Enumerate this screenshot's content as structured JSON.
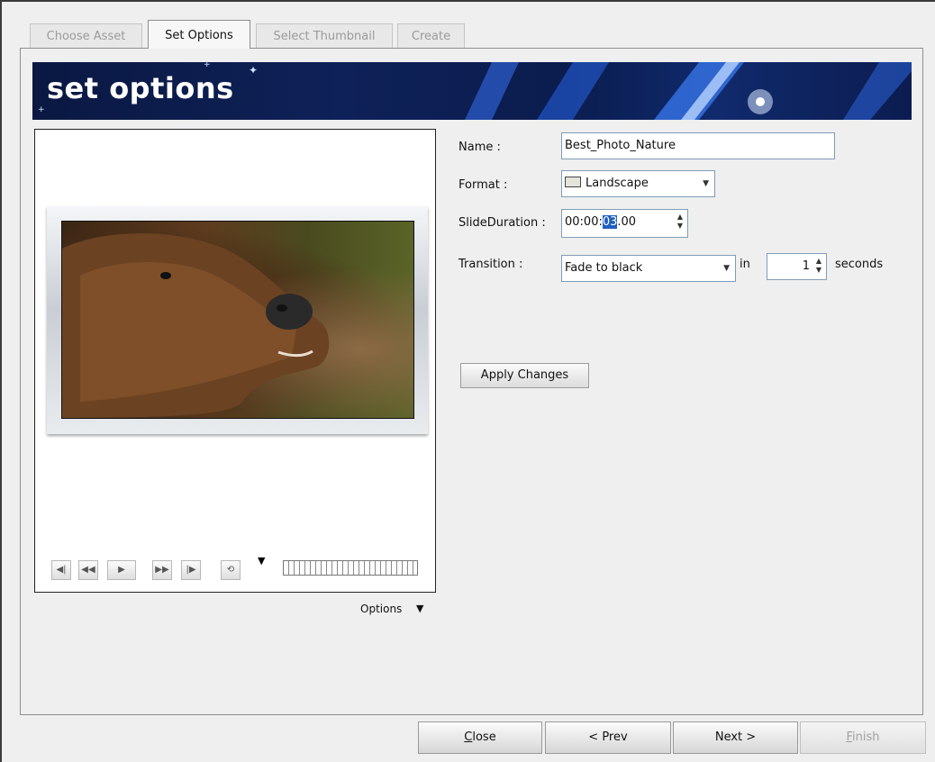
{
  "tabs": [
    {
      "label": "Choose Asset",
      "active": false
    },
    {
      "label": "Set Options",
      "active": true
    },
    {
      "label": "Select Thumbnail",
      "active": false
    },
    {
      "label": "Create",
      "active": false
    }
  ],
  "banner": {
    "title": "set options"
  },
  "preview": {
    "image": "brown-bear-photo",
    "controls": [
      "first-frame-icon",
      "step-back-icon",
      "play-icon",
      "step-forward-icon",
      "last-frame-icon",
      "loop-icon"
    ],
    "options_label": "Options"
  },
  "form": {
    "name_label": "Name :",
    "name_value": "Best_Photo_Nature",
    "format_label": "Format :",
    "format_value": "Landscape",
    "duration_label": "SlideDuration :",
    "duration_prefix": "00:00:",
    "duration_selected": "03",
    "duration_suffix": ".00",
    "transition_label": "Transition :",
    "transition_value": "Fade to black",
    "in_label": "in",
    "transition_seconds": "1",
    "seconds_label": "seconds",
    "apply_label": "Apply Changes"
  },
  "footer": {
    "close_label": "Close",
    "prev_label": "< Prev",
    "next_label": "Next >",
    "finish_label": "Finish",
    "finish_disabled": true
  },
  "colors": {
    "banner": "#0e2158",
    "selection": "#1f5fbf",
    "field_border": "#7f9db9"
  }
}
